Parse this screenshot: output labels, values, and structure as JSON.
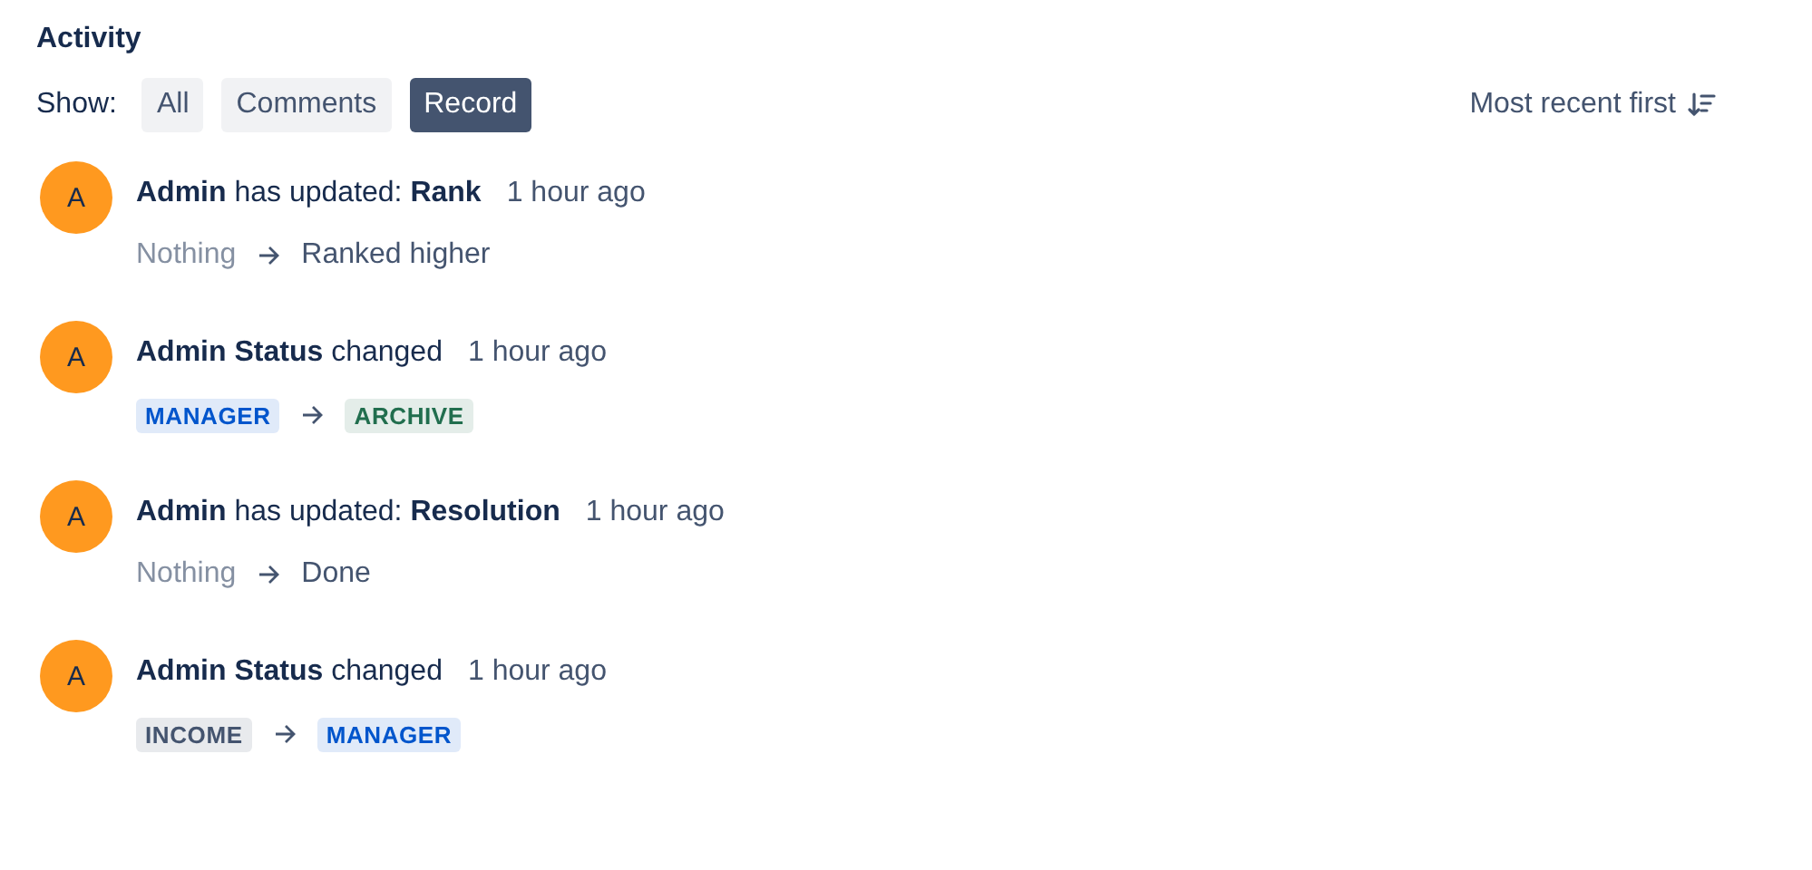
{
  "title": "Activity",
  "filter": {
    "label": "Show:",
    "options": [
      {
        "label": "All",
        "selected": false
      },
      {
        "label": "Comments",
        "selected": false
      },
      {
        "label": "Record",
        "selected": true
      }
    ]
  },
  "sort": {
    "label": "Most recent first"
  },
  "entries": [
    {
      "avatar": "A",
      "headline": "**Admin** has updated: **Rank**",
      "time": "1 hour ago",
      "kind": "text",
      "from": {
        "label": "Nothing"
      },
      "to": {
        "label": "Ranked higher"
      }
    },
    {
      "avatar": "A",
      "headline": "**Admin Status** changed",
      "time": "1 hour ago",
      "kind": "lozenge",
      "from": {
        "label": "MANAGER",
        "color": "#0055cc"
      },
      "to": {
        "label": "ARCHIVE",
        "color": "#216e4e"
      }
    },
    {
      "avatar": "A",
      "headline": "**Admin** has updated: **Resolution**",
      "time": "1 hour ago",
      "kind": "text",
      "from": {
        "label": "Nothing"
      },
      "to": {
        "label": "Done"
      }
    },
    {
      "avatar": "A",
      "headline": "**Admin Status** changed",
      "time": "1 hour ago",
      "kind": "lozenge",
      "from": {
        "label": "INCOME",
        "color": "#44546f"
      },
      "to": {
        "label": "MANAGER",
        "color": "#0055cc"
      }
    }
  ]
}
